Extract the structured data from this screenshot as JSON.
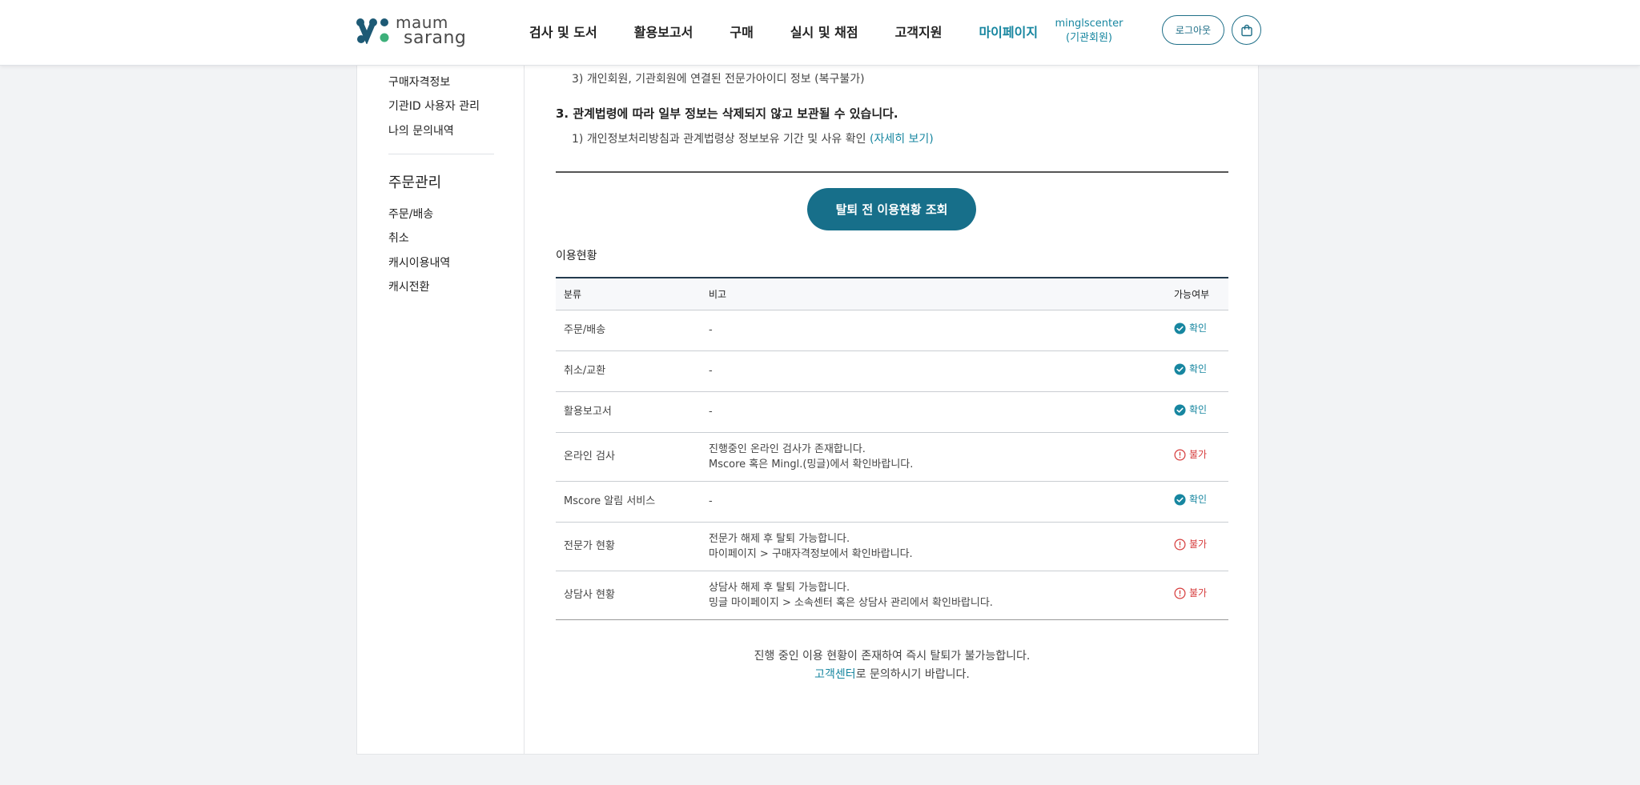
{
  "header": {
    "logo_text_line1": "maum",
    "logo_text_line2": "sarang",
    "nav": [
      "검사 및 도서",
      "활용보고서",
      "구매",
      "실시 및 채점",
      "고객지원",
      "마이페이지"
    ],
    "member_name": "minglscenter",
    "member_type": "(기관회원)",
    "logout_label": "로그아웃"
  },
  "sidebar": {
    "top_links": [
      "구매자격정보",
      "기관ID 사용자 관리",
      "나의 문의내역"
    ],
    "order_heading": "주문관리",
    "order_links": [
      "주문/배송",
      "취소",
      "캐시이용내역",
      "캐시전환"
    ]
  },
  "content": {
    "item3": "3)  개인회원, 기관회원에 연결된 전문가아이디 정보 (복구불가)",
    "section3_title": "3.  관계법령에 따라 일부 정보는 삭제되지 않고 보관될 수 있습니다.",
    "section3_item1_text": "1)  개인정보처리방침과 관계법령상 정보보유 기간 및 사유 확인 ",
    "section3_item1_link": "(자세히 보기)",
    "check_button_label": "탈퇴 전 이용현황 조회",
    "usage_title": "이용현황",
    "table_headers": [
      "분류",
      "비고",
      "가능여부"
    ],
    "rows": [
      {
        "category": "주문/배송",
        "note1": "-",
        "note2": "",
        "status": "확인",
        "ok": true
      },
      {
        "category": "취소/교환",
        "note1": "-",
        "note2": "",
        "status": "확인",
        "ok": true
      },
      {
        "category": "활용보고서",
        "note1": "-",
        "note2": "",
        "status": "확인",
        "ok": true
      },
      {
        "category": "온라인 검사",
        "note1": "진행중인 온라인 검사가 존재합니다.",
        "note2": "Mscore 혹은 Mingl.(밍글)에서 확인바랍니다.",
        "status": "불가",
        "ok": false
      },
      {
        "category": "Mscore 알림 서비스",
        "note1": "-",
        "note2": "",
        "status": "확인",
        "ok": true
      },
      {
        "category": "전문가 현황",
        "note1": "전문가 해제 후 탈퇴 가능합니다.",
        "note2": "마이페이지 > 구매자격정보에서 확인바랍니다.",
        "status": "불가",
        "ok": false
      },
      {
        "category": "상담사 현황",
        "note1": "상담사 해제 후 탈퇴 가능합니다.",
        "note2": "밍글 마이페이지 > 소속센터 혹은 상담사 관리에서 확인바랍니다.",
        "status": "불가",
        "ok": false
      }
    ],
    "notice_line1": "진행 중인 이용 현황이 존재하여 즉시 탈퇴가 불가능합니다.",
    "notice_link": "고객센터",
    "notice_line2_rest": "로 문의하시기 바랍니다."
  },
  "colors": {
    "accent": "#1786a0",
    "button_bg": "#176f8a",
    "error": "#d63b3b"
  }
}
